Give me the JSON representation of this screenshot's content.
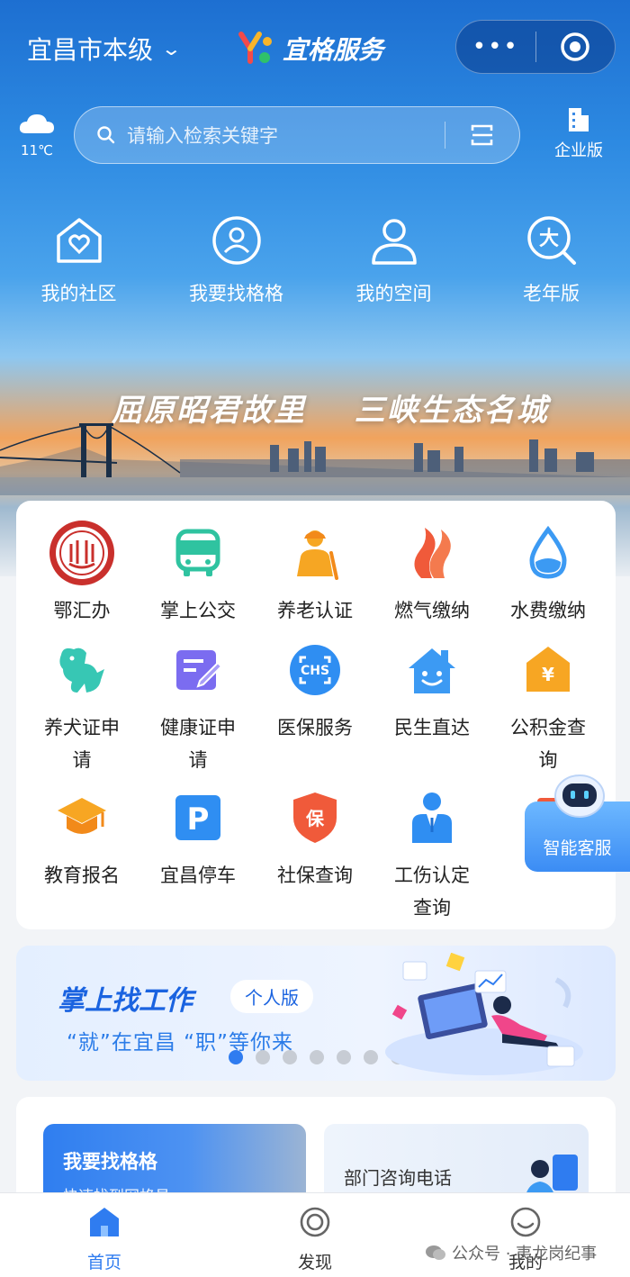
{
  "header": {
    "city": "宜昌市本级",
    "brand": "宜格服务",
    "more_label": "•••"
  },
  "weather": {
    "temp": "11℃"
  },
  "search": {
    "placeholder": "请输入检索关键字"
  },
  "enterprise": {
    "label": "企业版"
  },
  "top_entries": [
    {
      "label": "我的社区",
      "icon": "community-icon"
    },
    {
      "label": "我要找格格",
      "icon": "find-grid-icon"
    },
    {
      "label": "我的空间",
      "icon": "person-icon"
    },
    {
      "label": "老年版",
      "icon": "elderly-mode-icon"
    }
  ],
  "slogan": {
    "left": "屈原昭君故里",
    "right": "三峡生态名城"
  },
  "services": [
    {
      "label": "鄂汇办",
      "icon": "ehuiban-logo-icon"
    },
    {
      "label": "掌上公交",
      "icon": "bus-icon"
    },
    {
      "label": "养老认证",
      "icon": "elderly-icon"
    },
    {
      "label": "燃气缴纳",
      "icon": "flame-icon"
    },
    {
      "label": "水费缴纳",
      "icon": "water-drop-icon"
    },
    {
      "label": "养犬证申请",
      "icon": "dog-icon"
    },
    {
      "label": "健康证申请",
      "icon": "health-card-icon"
    },
    {
      "label": "医保服务",
      "icon": "chs-icon"
    },
    {
      "label": "民生直达",
      "icon": "house-smile-icon"
    },
    {
      "label": "公积金查询",
      "icon": "fund-house-icon"
    },
    {
      "label": "教育报名",
      "icon": "graduation-cap-icon"
    },
    {
      "label": "宜昌停车",
      "icon": "parking-icon"
    },
    {
      "label": "社保查询",
      "icon": "social-security-icon"
    },
    {
      "label": "工伤认定查询",
      "icon": "worker-icon"
    }
  ],
  "assistant": {
    "label": "智能客服"
  },
  "job_banner": {
    "title": "掌上找工作",
    "tag": "个人版",
    "subtitle": "“就”在宜昌 “职”等你来",
    "slides_total": 7,
    "active_slide": 1
  },
  "cards": {
    "find_title": "我要找格格",
    "find_sub": "快速找到网格员",
    "dept_title": "部门咨询电话"
  },
  "nav": [
    {
      "label": "首页",
      "icon": "home-icon",
      "active": true
    },
    {
      "label": "发现",
      "icon": "discover-icon",
      "active": false
    },
    {
      "label": "我的",
      "icon": "smile-icon",
      "active": false
    }
  ],
  "watermark": {
    "text": "公众号 · 夷龙岗纪事"
  },
  "colors": {
    "primary": "#2f7cf0",
    "hero_top": "#1d6fd1"
  }
}
